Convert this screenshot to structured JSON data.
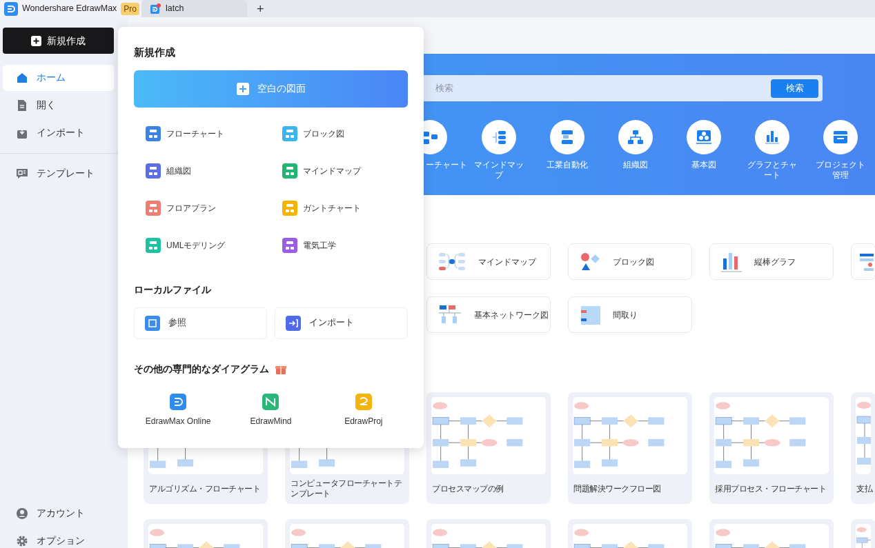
{
  "title_bar": {
    "app_name": "Wondershare EdrawMax",
    "badge": "Pro",
    "tabs": [
      {
        "label": "latch",
        "selected": false
      }
    ],
    "new_tab": "+"
  },
  "sidebar": {
    "new_button": "新規作成",
    "items": [
      {
        "label": "ホーム",
        "selected": true
      },
      {
        "label": "開く",
        "selected": false
      },
      {
        "label": "インポート",
        "selected": false
      },
      {
        "label": "テンプレート",
        "selected": false
      }
    ],
    "bottom_items": [
      {
        "label": "アカウント"
      },
      {
        "label": "オプション"
      }
    ]
  },
  "banner": {
    "search": {
      "placeholder": "検索",
      "button": "検索"
    },
    "categories": [
      {
        "label": "ーチャート"
      },
      {
        "label": "マインドマップ"
      },
      {
        "label": "工業自動化"
      },
      {
        "label": "組織図"
      },
      {
        "label": "基本図"
      },
      {
        "label": "グラフとチャート"
      },
      {
        "label": "プロジェクト管理"
      }
    ]
  },
  "quick_cards": [
    {
      "label": "マインドマップ",
      "kind": "mind"
    },
    {
      "label": "ブロック図",
      "kind": "block"
    },
    {
      "label": "縦棒グラフ",
      "kind": "bar"
    },
    {
      "kind": "gantt"
    },
    {
      "label": "基本ネットワーク図",
      "kind": "network"
    },
    {
      "label": "間取り",
      "kind": "floor"
    }
  ],
  "templates": [
    {
      "label": "アルゴリズム・フローチャート"
    },
    {
      "label": "コンピュータフローチャートテンプレート"
    },
    {
      "label": "プロセスマップの例"
    },
    {
      "label": "問題解決ワークフロー図"
    },
    {
      "label": "採用プロセス・フローチャート"
    },
    {
      "label": "支払"
    }
  ],
  "popup": {
    "title": "新規作成",
    "blank": "空白の図面",
    "types": [
      {
        "label": "フローチャート",
        "color": "#3b82e6"
      },
      {
        "label": "ブロック図",
        "color": "#3cb4ee"
      },
      {
        "label": "組織図",
        "color": "#5b6ee8"
      },
      {
        "label": "マインドマップ",
        "color": "#22b573"
      },
      {
        "label": "フロアプラン",
        "color": "#ef7d72"
      },
      {
        "label": "ガントチャート",
        "color": "#f5b400"
      },
      {
        "label": "UMLモデリング",
        "color": "#1fc2a0"
      },
      {
        "label": "電気工学",
        "color": "#9b5de5"
      }
    ],
    "local_title": "ローカルファイル",
    "local": [
      {
        "label": "参照",
        "color": "#3b8cf0"
      },
      {
        "label": "インポート",
        "color": "#4f6bea"
      }
    ],
    "more_title": "その他の専門的なダイアグラム",
    "apps": [
      {
        "label": "EdrawMax Online",
        "color": "#2f8df2"
      },
      {
        "label": "EdrawMind",
        "color": "#2ab87a"
      },
      {
        "label": "EdrawProj",
        "color": "#f5b40a"
      }
    ]
  }
}
